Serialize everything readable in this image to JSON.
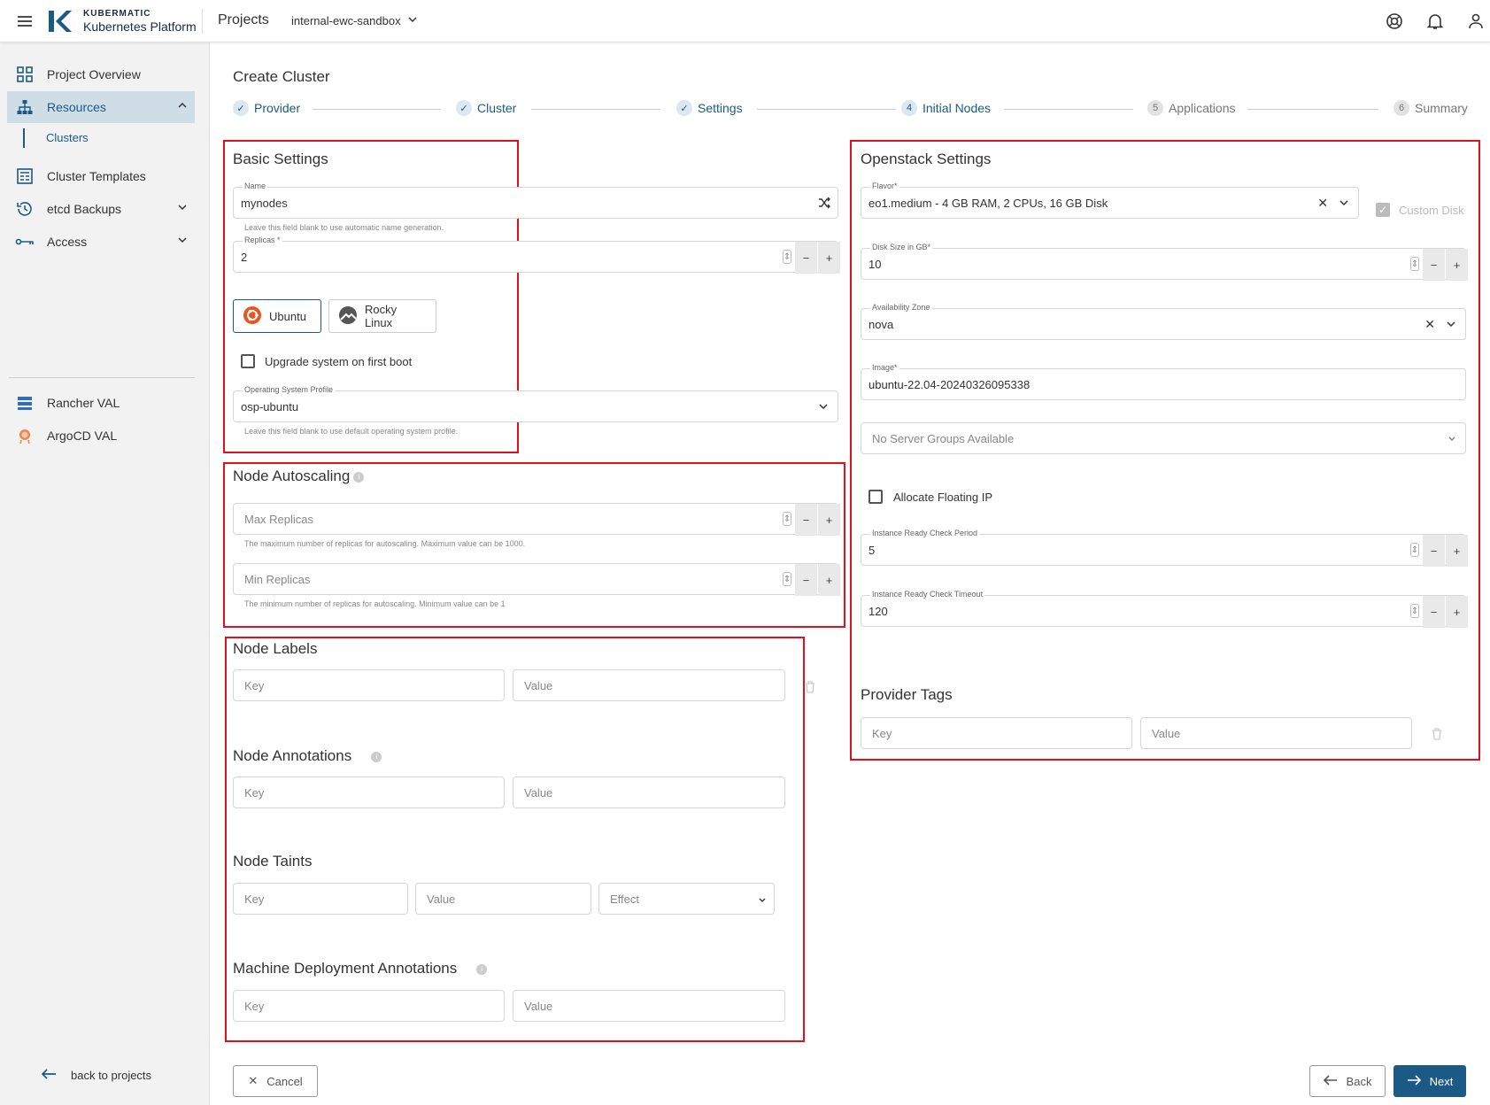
{
  "topbar": {
    "brand_top": "KUBERMATIC",
    "brand_bottom": "Kubernetes Platform",
    "projects_label": "Projects",
    "project_selector": "internal-ewc-sandbox"
  },
  "sidebar": {
    "items": [
      {
        "label": "Project Overview"
      },
      {
        "label": "Resources"
      },
      {
        "label": "Clusters"
      },
      {
        "label": "Cluster Templates"
      },
      {
        "label": "etcd Backups"
      },
      {
        "label": "Access"
      },
      {
        "label": "Rancher VAL"
      },
      {
        "label": "ArgoCD VAL"
      }
    ],
    "back_label": "back to projects"
  },
  "page": {
    "title": "Create Cluster"
  },
  "stepper": [
    {
      "num": "",
      "label": "Provider",
      "state": "done"
    },
    {
      "num": "",
      "label": "Cluster",
      "state": "done"
    },
    {
      "num": "",
      "label": "Settings",
      "state": "done"
    },
    {
      "num": "4",
      "label": "Initial Nodes",
      "state": "current"
    },
    {
      "num": "5",
      "label": "Applications",
      "state": "upcoming"
    },
    {
      "num": "6",
      "label": "Summary",
      "state": "upcoming"
    }
  ],
  "basic": {
    "title": "Basic Settings",
    "name_label": "Name",
    "name_value": "mynodes",
    "name_hint": "Leave this field blank to use automatic name generation.",
    "replicas_label": "Replicas *",
    "replicas_value": "2",
    "os_ubuntu": "Ubuntu",
    "os_rocky": "Rocky Linux",
    "upgrade_label": "Upgrade system on first boot",
    "osp_label": "Operating System Profile",
    "osp_value": "osp-ubuntu",
    "osp_hint": "Leave this field blank to use default operating system profile."
  },
  "autoscaling": {
    "title": "Node Autoscaling",
    "max_placeholder": "Max Replicas",
    "max_hint": "The maximum number of replicas for autoscaling. Maximum value can be 1000.",
    "min_placeholder": "Min Replicas",
    "min_hint": "The minimum number of replicas for autoscaling. Minimum value can be 1"
  },
  "labels": {
    "node_labels_title": "Node Labels",
    "node_annotations_title": "Node Annotations",
    "node_taints_title": "Node Taints",
    "md_annotations_title": "Machine Deployment Annotations",
    "key_placeholder": "Key",
    "value_placeholder": "Value",
    "effect_placeholder": "Effect"
  },
  "openstack": {
    "title": "Openstack Settings",
    "flavor_label": "Flavor*",
    "flavor_value": "eo1.medium - 4 GB RAM, 2 CPUs, 16 GB Disk",
    "custom_disk": "Custom Disk",
    "disk_label": "Disk Size in GB*",
    "disk_value": "10",
    "az_label": "Availability Zone",
    "az_value": "nova",
    "image_label": "Image*",
    "image_value": "ubuntu-22.04-20240326095338",
    "server_groups": "No Server Groups Available",
    "floating_ip": "Allocate Floating IP",
    "ready_period_label": "Instance Ready Check Period",
    "ready_period_value": "5",
    "ready_timeout_label": "Instance Ready Check Timeout",
    "ready_timeout_value": "120",
    "provider_tags_title": "Provider Tags"
  },
  "footer": {
    "cancel": "Cancel",
    "back": "Back",
    "next": "Next"
  }
}
